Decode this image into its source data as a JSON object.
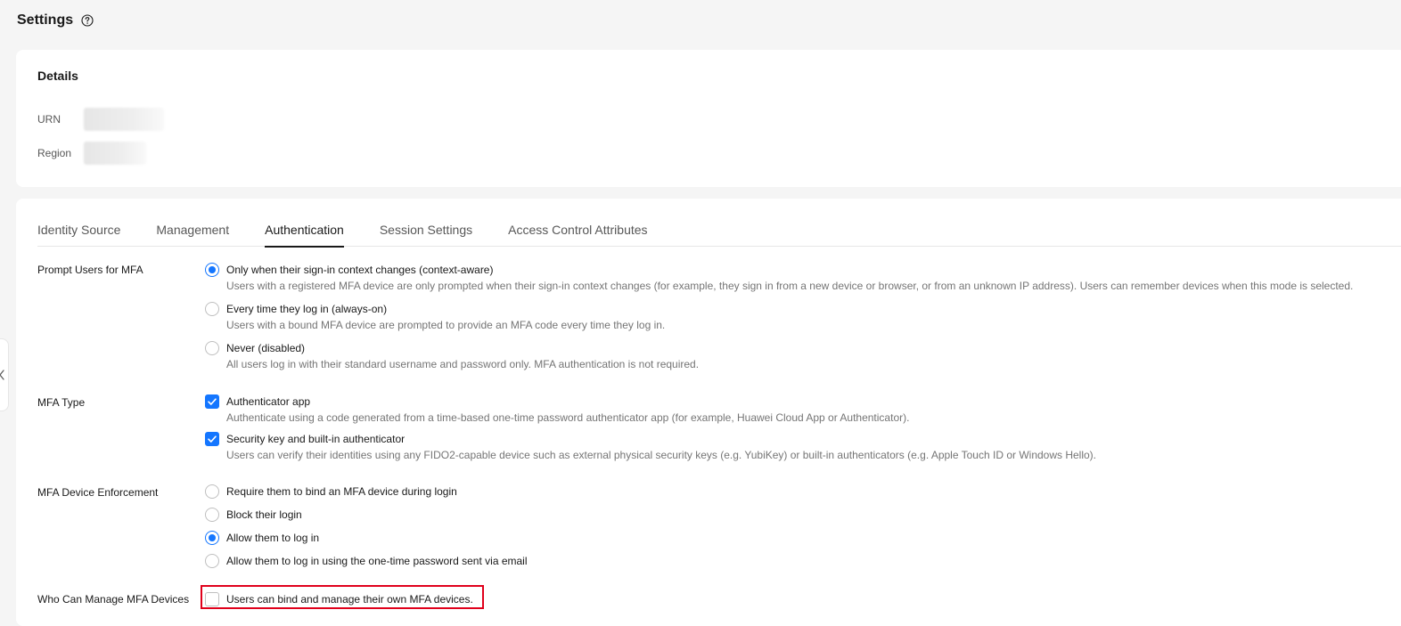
{
  "header": {
    "title": "Settings",
    "help_icon": "question-circle-icon"
  },
  "details": {
    "title": "Details",
    "rows": [
      {
        "label": "URN",
        "value_state": "redacted"
      },
      {
        "label": "Region",
        "value_state": "redacted"
      }
    ]
  },
  "tabs": [
    {
      "label": "Identity Source",
      "active": false
    },
    {
      "label": "Management",
      "active": false
    },
    {
      "label": "Authentication",
      "active": true
    },
    {
      "label": "Session Settings",
      "active": false
    },
    {
      "label": "Access Control Attributes",
      "active": false
    }
  ],
  "prompt_mfa": {
    "label": "Prompt Users for MFA",
    "options": [
      {
        "label": "Only when their sign-in context changes (context-aware)",
        "desc": "Users with a registered MFA device are only prompted when their sign-in context changes (for example, they sign in from a new device or browser, or from an unknown IP address). Users can remember devices when this mode is selected.",
        "selected": true
      },
      {
        "label": "Every time they log in (always-on)",
        "desc": "Users with a bound MFA device are prompted to provide an MFA code every time they log in.",
        "selected": false
      },
      {
        "label": "Never (disabled)",
        "desc": "All users log in with their standard username and password only. MFA authentication is not required.",
        "selected": false
      }
    ]
  },
  "mfa_type": {
    "label": "MFA Type",
    "options": [
      {
        "label": "Authenticator app",
        "desc": "Authenticate using a code generated from a time-based one-time password authenticator app (for example, Huawei Cloud App or Authenticator).",
        "checked": true
      },
      {
        "label": "Security key and built-in authenticator",
        "desc": "Users can verify their identities using any FIDO2-capable device such as external physical security keys (e.g. YubiKey) or built-in authenticators (e.g. Apple Touch ID or Windows Hello).",
        "checked": true
      }
    ]
  },
  "enforcement": {
    "label": "MFA Device Enforcement",
    "options": [
      {
        "label": "Require them to bind an MFA device during login",
        "selected": false
      },
      {
        "label": "Block their login",
        "selected": false
      },
      {
        "label": "Allow them to log in",
        "selected": true
      },
      {
        "label": "Allow them to log in using the one-time password sent via email",
        "selected": false
      }
    ]
  },
  "manage": {
    "label": "Who Can Manage MFA Devices",
    "option": {
      "label": "Users can bind and manage their own MFA devices.",
      "checked": false
    }
  },
  "colors": {
    "accent": "#1476ff",
    "highlight": "#e0001b"
  }
}
